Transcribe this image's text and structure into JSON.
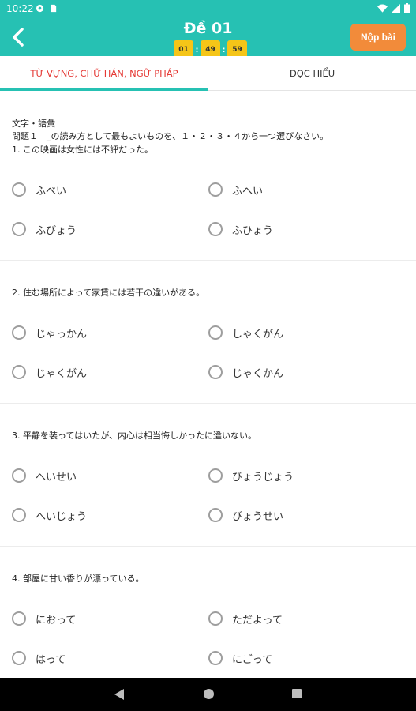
{
  "status": {
    "time": "10:22"
  },
  "header": {
    "title": "Đề 01",
    "timer": {
      "hours": "01",
      "minutes": "49",
      "seconds": "59"
    },
    "submit_label": "Nộp bài"
  },
  "tabs": [
    {
      "label": "TỪ VỰNG, CHỮ HÁN, NGỮ PHÁP",
      "active": true
    },
    {
      "label": "ĐỌC HIỂU",
      "active": false
    }
  ],
  "section": {
    "title": "文字・語彙",
    "instruction": "問題１　_の読み方として最もよいものを、１・２・３・４から一つ選びなさい。"
  },
  "questions": [
    {
      "text": "1. この映画は女性には不評だった。",
      "options": [
        "ふべい",
        "ふへい",
        "ふびょう",
        "ふひょう"
      ]
    },
    {
      "text": "2. 住む場所によって家賃には若干の違いがある。",
      "options": [
        "じゃっかん",
        "しゃくがん",
        "じゃくがん",
        "じゃくかん"
      ]
    },
    {
      "text": "3. 平静を装ってはいたが、内心は相当悔しかったに違いない。",
      "options": [
        "へいせい",
        "びょうじょう",
        "へいじょう",
        "びょうせい"
      ]
    },
    {
      "text": "4. 部屋に甘い香りが漂っている。",
      "options": [
        "におって",
        "ただよって",
        "はって",
        "にごって"
      ]
    }
  ],
  "colors": {
    "header": "#26c1b3",
    "accent_tab": "#e53935",
    "timer": "#f5c518",
    "submit": "#f28b3a"
  }
}
